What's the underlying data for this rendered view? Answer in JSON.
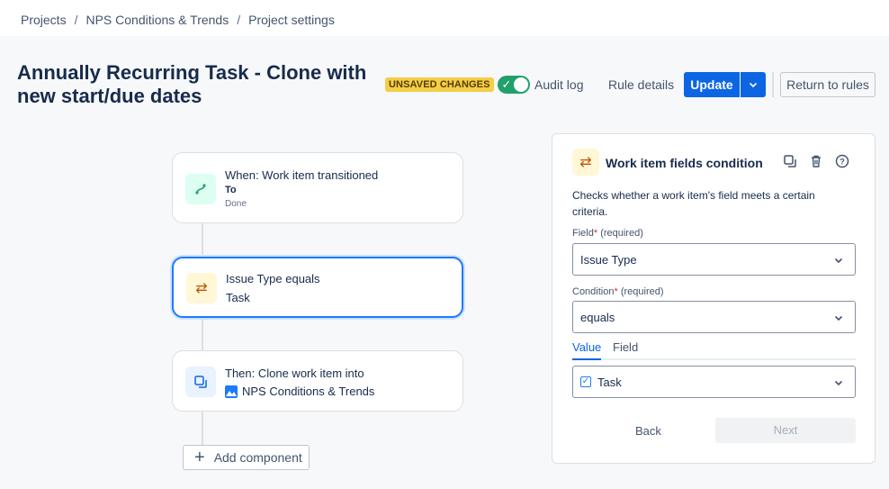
{
  "breadcrumbs": [
    "Projects",
    "NPS Conditions & Trends",
    "Project settings"
  ],
  "page_title": "Annually Recurring Task - Clone with new start/due dates",
  "header": {
    "unsaved_badge": "UNSAVED CHANGES",
    "toggle_enabled": true,
    "audit_log": "Audit log",
    "rule_details": "Rule details",
    "update": "Update",
    "return_to_rules": "Return to rules"
  },
  "flow": {
    "trigger": {
      "title": "When: Work item transitioned",
      "sub1": "To",
      "sub2": "Done"
    },
    "condition": {
      "title": "Issue Type equals",
      "sub1": "Task"
    },
    "action": {
      "title": "Then: Clone work item into",
      "sub1": "NPS Conditions & Trends"
    },
    "add_component": "Add component"
  },
  "panel": {
    "title": "Work item fields condition",
    "description": "Checks whether a work item's field meets a certain criteria.",
    "field_label": "Field",
    "field_required": "(required)",
    "field_value": "Issue Type",
    "condition_label": "Condition",
    "condition_required": "(required)",
    "condition_value": "equals",
    "tabs": [
      "Value",
      "Field"
    ],
    "active_tab": "Value",
    "value_selected": "Task",
    "back": "Back",
    "next": "Next"
  },
  "colors": {
    "primary": "#0c66e4",
    "badge": "#f5cd47",
    "toggle_on": "#22a06b",
    "selected_border": "#1d7afc"
  }
}
